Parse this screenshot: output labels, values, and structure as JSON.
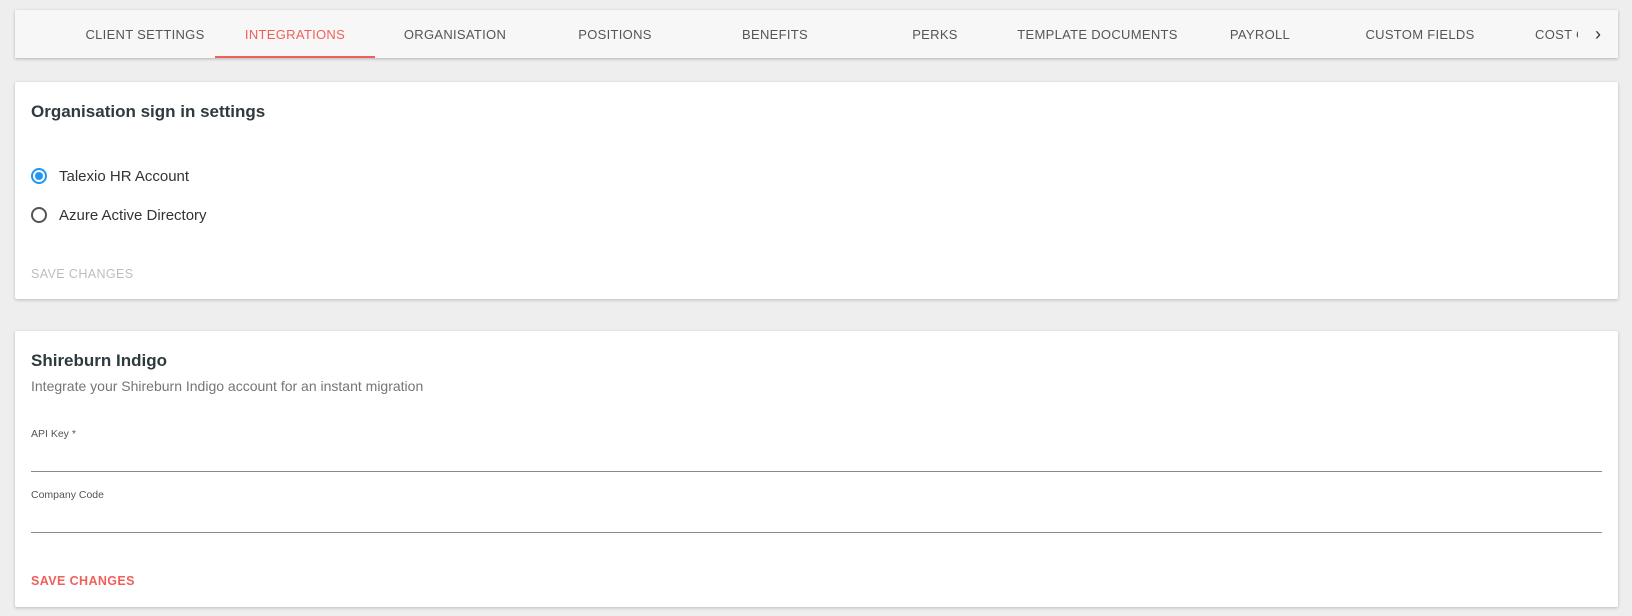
{
  "tabs": {
    "items": [
      {
        "label": "CLIENT SETTINGS"
      },
      {
        "label": "INTEGRATIONS"
      },
      {
        "label": "ORGANISATION"
      },
      {
        "label": "POSITIONS"
      },
      {
        "label": "BENEFITS"
      },
      {
        "label": "PERKS"
      },
      {
        "label": "TEMPLATE DOCUMENTS"
      },
      {
        "label": "PAYROLL"
      },
      {
        "label": "CUSTOM FIELDS"
      },
      {
        "label": "COST C"
      }
    ],
    "active": "INTEGRATIONS",
    "next_icon": "chevron-right-icon",
    "next_glyph": "›"
  },
  "sign_in_card": {
    "title": "Organisation sign in settings",
    "options": [
      {
        "label": "Talexio HR Account",
        "checked": true
      },
      {
        "label": "Azure Active Directory",
        "checked": false
      }
    ],
    "save_label": "SAVE CHANGES"
  },
  "shireburn_card": {
    "title": "Shireburn Indigo",
    "subtitle": "Integrate your Shireburn Indigo account for an instant migration",
    "api_key_label": "API Key *",
    "api_key_value": "",
    "company_code_label": "Company Code",
    "company_code_value": "",
    "save_label": "SAVE CHANGES"
  },
  "colors": {
    "accent": "#f0605a",
    "radio_checked": "#2196f3",
    "background": "#eeeeee"
  }
}
